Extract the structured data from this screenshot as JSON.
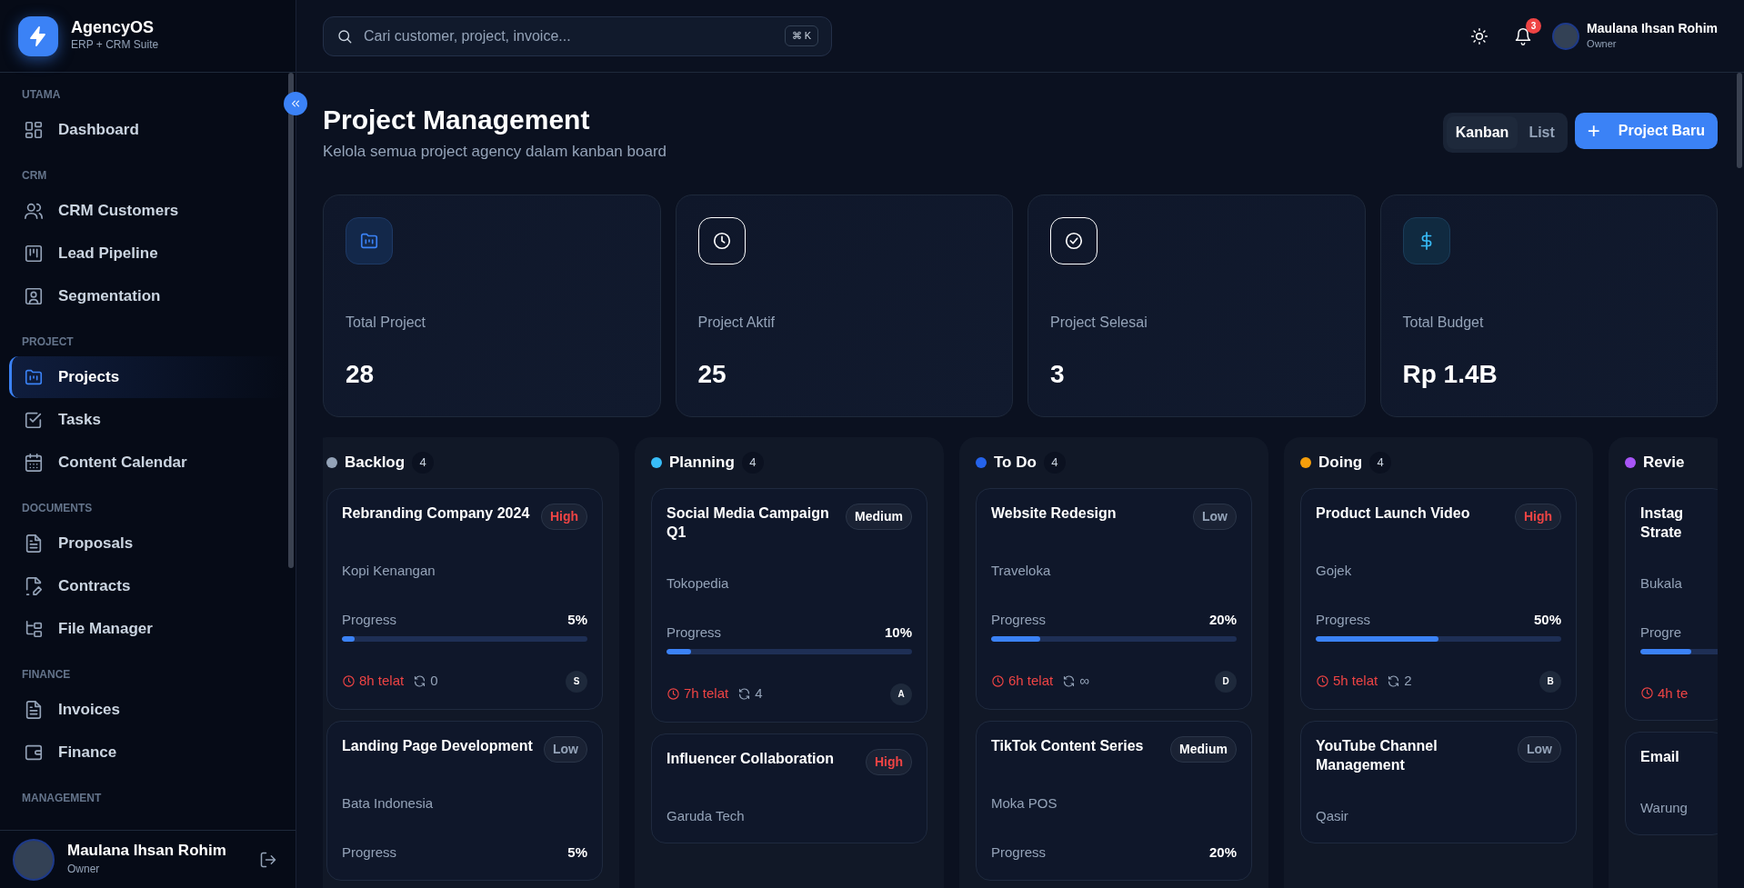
{
  "brand": {
    "name": "AgencyOS",
    "tagline": "ERP + CRM Suite"
  },
  "sidebar": {
    "sections": [
      {
        "label": "UTAMA",
        "items": [
          {
            "label": "Dashboard",
            "selected": false
          }
        ]
      },
      {
        "label": "CRM",
        "items": [
          {
            "label": "CRM Customers",
            "selected": false
          },
          {
            "label": "Lead Pipeline",
            "selected": false
          },
          {
            "label": "Segmentation",
            "selected": false
          }
        ]
      },
      {
        "label": "PROJECT",
        "items": [
          {
            "label": "Projects",
            "selected": true
          },
          {
            "label": "Tasks",
            "selected": false
          },
          {
            "label": "Content Calendar",
            "selected": false
          }
        ]
      },
      {
        "label": "DOCUMENTS",
        "items": [
          {
            "label": "Proposals",
            "selected": false
          },
          {
            "label": "Contracts",
            "selected": false
          },
          {
            "label": "File Manager",
            "selected": false
          }
        ]
      },
      {
        "label": "FINANCE",
        "items": [
          {
            "label": "Invoices",
            "selected": false
          },
          {
            "label": "Finance",
            "selected": false
          }
        ]
      },
      {
        "label": "MANAGEMENT"
      }
    ],
    "user": {
      "name": "Maulana Ihsan Rohim",
      "role": "Owner"
    }
  },
  "topbar": {
    "search": {
      "placeholder": "Cari customer, project, invoice...",
      "shortcut": "⌘ K"
    },
    "notifications": "3",
    "user": {
      "name": "Maulana Ihsan Rohim",
      "role": "Owner"
    }
  },
  "header": {
    "title": "Project Management",
    "subtitle": "Kelola semua project agency dalam kanban board",
    "views": [
      {
        "label": "Kanban",
        "selected": true
      },
      {
        "label": "List",
        "selected": false
      }
    ],
    "new_button": {
      "icon": "+",
      "label": "Project Baru"
    }
  },
  "stats": [
    {
      "kind": "folder",
      "label": "Total Project",
      "value": "28"
    },
    {
      "kind": "clock",
      "label": "Project Aktif",
      "value": "25"
    },
    {
      "kind": "check",
      "label": "Project Selesai",
      "value": "3"
    },
    {
      "kind": "dollar",
      "label": "Total Budget",
      "value": "Rp 1.4B"
    }
  ],
  "board": {
    "columns": [
      {
        "name": "Backlog",
        "count": "4",
        "color": "#94a3b8",
        "cards": [
          {
            "title": "Rebranding Company 2024",
            "priority": {
              "label": "High",
              "color": "#ef4444"
            },
            "client": "Kopi Kenangan",
            "progress_label": "Progress",
            "progress": "5%",
            "level": 0.05,
            "late": "8h telat",
            "repeat": "0",
            "assignee": "S"
          },
          {
            "title": "Landing Page Development",
            "priority": {
              "label": "Low",
              "color": "#94a3b8"
            },
            "client": "Bata Indonesia",
            "progress_label": "Progress",
            "progress": "5%"
          }
        ]
      },
      {
        "name": "Planning",
        "count": "4",
        "color": "#38bdf8",
        "cards": [
          {
            "title": "Social Media Campaign Q1",
            "priority": {
              "label": "Medium",
              "color": "#ffffff"
            },
            "client": "Tokopedia",
            "progress_label": "Progress",
            "progress": "10%",
            "level": 0.1,
            "late": "7h telat",
            "repeat": "4",
            "assignee": "A"
          },
          {
            "title": "Influencer Collaboration",
            "priority": {
              "label": "High",
              "color": "#ef4444"
            },
            "client": "Garuda Tech"
          }
        ]
      },
      {
        "name": "To Do",
        "count": "4",
        "color": "#2563eb",
        "cards": [
          {
            "title": "Website Redesign",
            "priority": {
              "label": "Low",
              "color": "#94a3b8"
            },
            "client": "Traveloka",
            "progress_label": "Progress",
            "progress": "20%",
            "level": 0.2,
            "late": "6h telat",
            "repeat": "∞",
            "assignee": "D"
          },
          {
            "title": "TikTok Content Series",
            "priority": {
              "label": "Medium",
              "color": "#ffffff"
            },
            "client": "Moka POS",
            "progress_label": "Progress",
            "progress": "20%"
          }
        ]
      },
      {
        "name": "Doing",
        "count": "4",
        "color": "#f59e0b",
        "cards": [
          {
            "title": "Product Launch Video",
            "priority": {
              "label": "High",
              "color": "#ef4444"
            },
            "client": "Gojek",
            "progress_label": "Progress",
            "progress": "50%",
            "level": 0.5,
            "late": "5h telat",
            "repeat": "2",
            "assignee": "B"
          },
          {
            "title": "YouTube Channel Management",
            "priority": {
              "label": "Low",
              "color": "#94a3b8"
            },
            "client": "Qasir"
          }
        ]
      },
      {
        "name": "Revie",
        "color": "#a855f7",
        "cards": [
          {
            "title": "Instag Strate",
            "client": "Bukala",
            "progress_label": "Progre",
            "level": 0.6,
            "late": "4h te"
          },
          {
            "title": "Email",
            "client": "Warung"
          }
        ]
      }
    ]
  }
}
